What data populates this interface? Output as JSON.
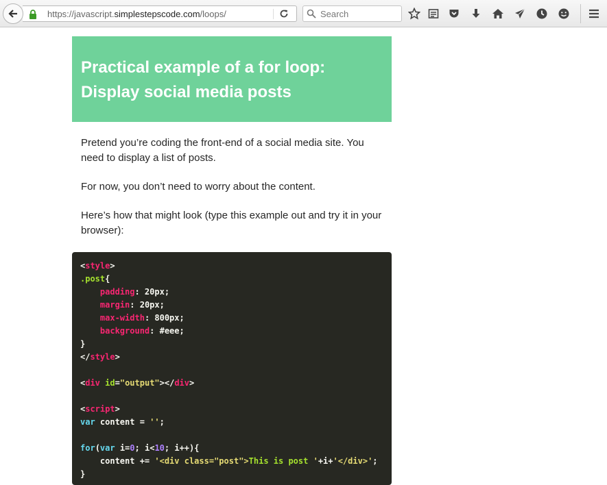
{
  "browser": {
    "url_prefix": "https://javascript.",
    "url_domain": "simplestepscode.com",
    "url_path": "/loops/",
    "search_placeholder": "Search",
    "toolbar_icons": [
      "bookmark-star-icon",
      "reading-list-icon",
      "pocket-icon",
      "download-icon",
      "home-icon",
      "send-icon",
      "history-icon",
      "emoji-icon"
    ]
  },
  "article": {
    "heading": "Practical example of a for loop: Display social media posts",
    "paragraphs": [
      "Pretend you’re coding the front-end of a social media site. You need to display a list of posts.",
      "For now, you don’t need to worry about the content.",
      "Here’s how that might look (type this example out and try it in your browser):"
    ]
  },
  "code": {
    "lines": [
      [
        [
          "<",
          "#f8f8f2"
        ],
        [
          "style",
          "#f92672"
        ],
        [
          ">",
          "#f8f8f2"
        ]
      ],
      [
        [
          ".post",
          "#a6e22e"
        ],
        [
          "{",
          "#f8f8f2"
        ]
      ],
      [
        [
          "    ",
          "#f8f8f2"
        ],
        [
          "padding",
          "#f92672"
        ],
        [
          ": 20px;",
          "#f8f8f2"
        ]
      ],
      [
        [
          "    ",
          "#f8f8f2"
        ],
        [
          "margin",
          "#f92672"
        ],
        [
          ": 20px;",
          "#f8f8f2"
        ]
      ],
      [
        [
          "    ",
          "#f8f8f2"
        ],
        [
          "max-width",
          "#f92672"
        ],
        [
          ": 800px;",
          "#f8f8f2"
        ]
      ],
      [
        [
          "    ",
          "#f8f8f2"
        ],
        [
          "background",
          "#f92672"
        ],
        [
          ": #eee;",
          "#f8f8f2"
        ]
      ],
      [
        [
          "}",
          "#f8f8f2"
        ]
      ],
      [
        [
          "</",
          "#f8f8f2"
        ],
        [
          "style",
          "#f92672"
        ],
        [
          ">",
          "#f8f8f2"
        ]
      ],
      [
        [
          "",
          ""
        ]
      ],
      [
        [
          "<",
          "#f8f8f2"
        ],
        [
          "div",
          "#f92672"
        ],
        [
          " ",
          "#f8f8f2"
        ],
        [
          "id",
          "#a6e22e"
        ],
        [
          "=",
          "#f8f8f2"
        ],
        [
          "\"output\"",
          "#e6db74"
        ],
        [
          "></",
          "#f8f8f2"
        ],
        [
          "div",
          "#f92672"
        ],
        [
          ">",
          "#f8f8f2"
        ]
      ],
      [
        [
          "",
          ""
        ]
      ],
      [
        [
          "<",
          "#f8f8f2"
        ],
        [
          "script",
          "#f92672"
        ],
        [
          ">",
          "#f8f8f2"
        ]
      ],
      [
        [
          "var",
          "#66d9ef"
        ],
        [
          " content = ",
          "#f8f8f2"
        ],
        [
          "''",
          "#e6db74"
        ],
        [
          ";",
          "#f8f8f2"
        ]
      ],
      [
        [
          "",
          ""
        ]
      ],
      [
        [
          "for",
          "#66d9ef"
        ],
        [
          "(",
          "#f8f8f2"
        ],
        [
          "var",
          "#66d9ef"
        ],
        [
          " i=",
          "#f8f8f2"
        ],
        [
          "0",
          "#ae81ff"
        ],
        [
          "; i<",
          "#f8f8f2"
        ],
        [
          "10",
          "#ae81ff"
        ],
        [
          "; i++){",
          "#f8f8f2"
        ]
      ],
      [
        [
          "    content += ",
          "#f8f8f2"
        ],
        [
          "'<div class=\"post\">",
          "#e6db74"
        ],
        [
          "This is post ",
          "#a6e22e"
        ],
        [
          "'",
          "#e6db74"
        ],
        [
          "+i+",
          "#f8f8f2"
        ],
        [
          "'</div>'",
          "#e6db74"
        ],
        [
          ";",
          "#f8f8f2"
        ]
      ],
      [
        [
          "}",
          "#f8f8f2"
        ]
      ]
    ]
  },
  "colors": {
    "hero_bg": "#6fd29a",
    "code_bg": "#272822"
  }
}
